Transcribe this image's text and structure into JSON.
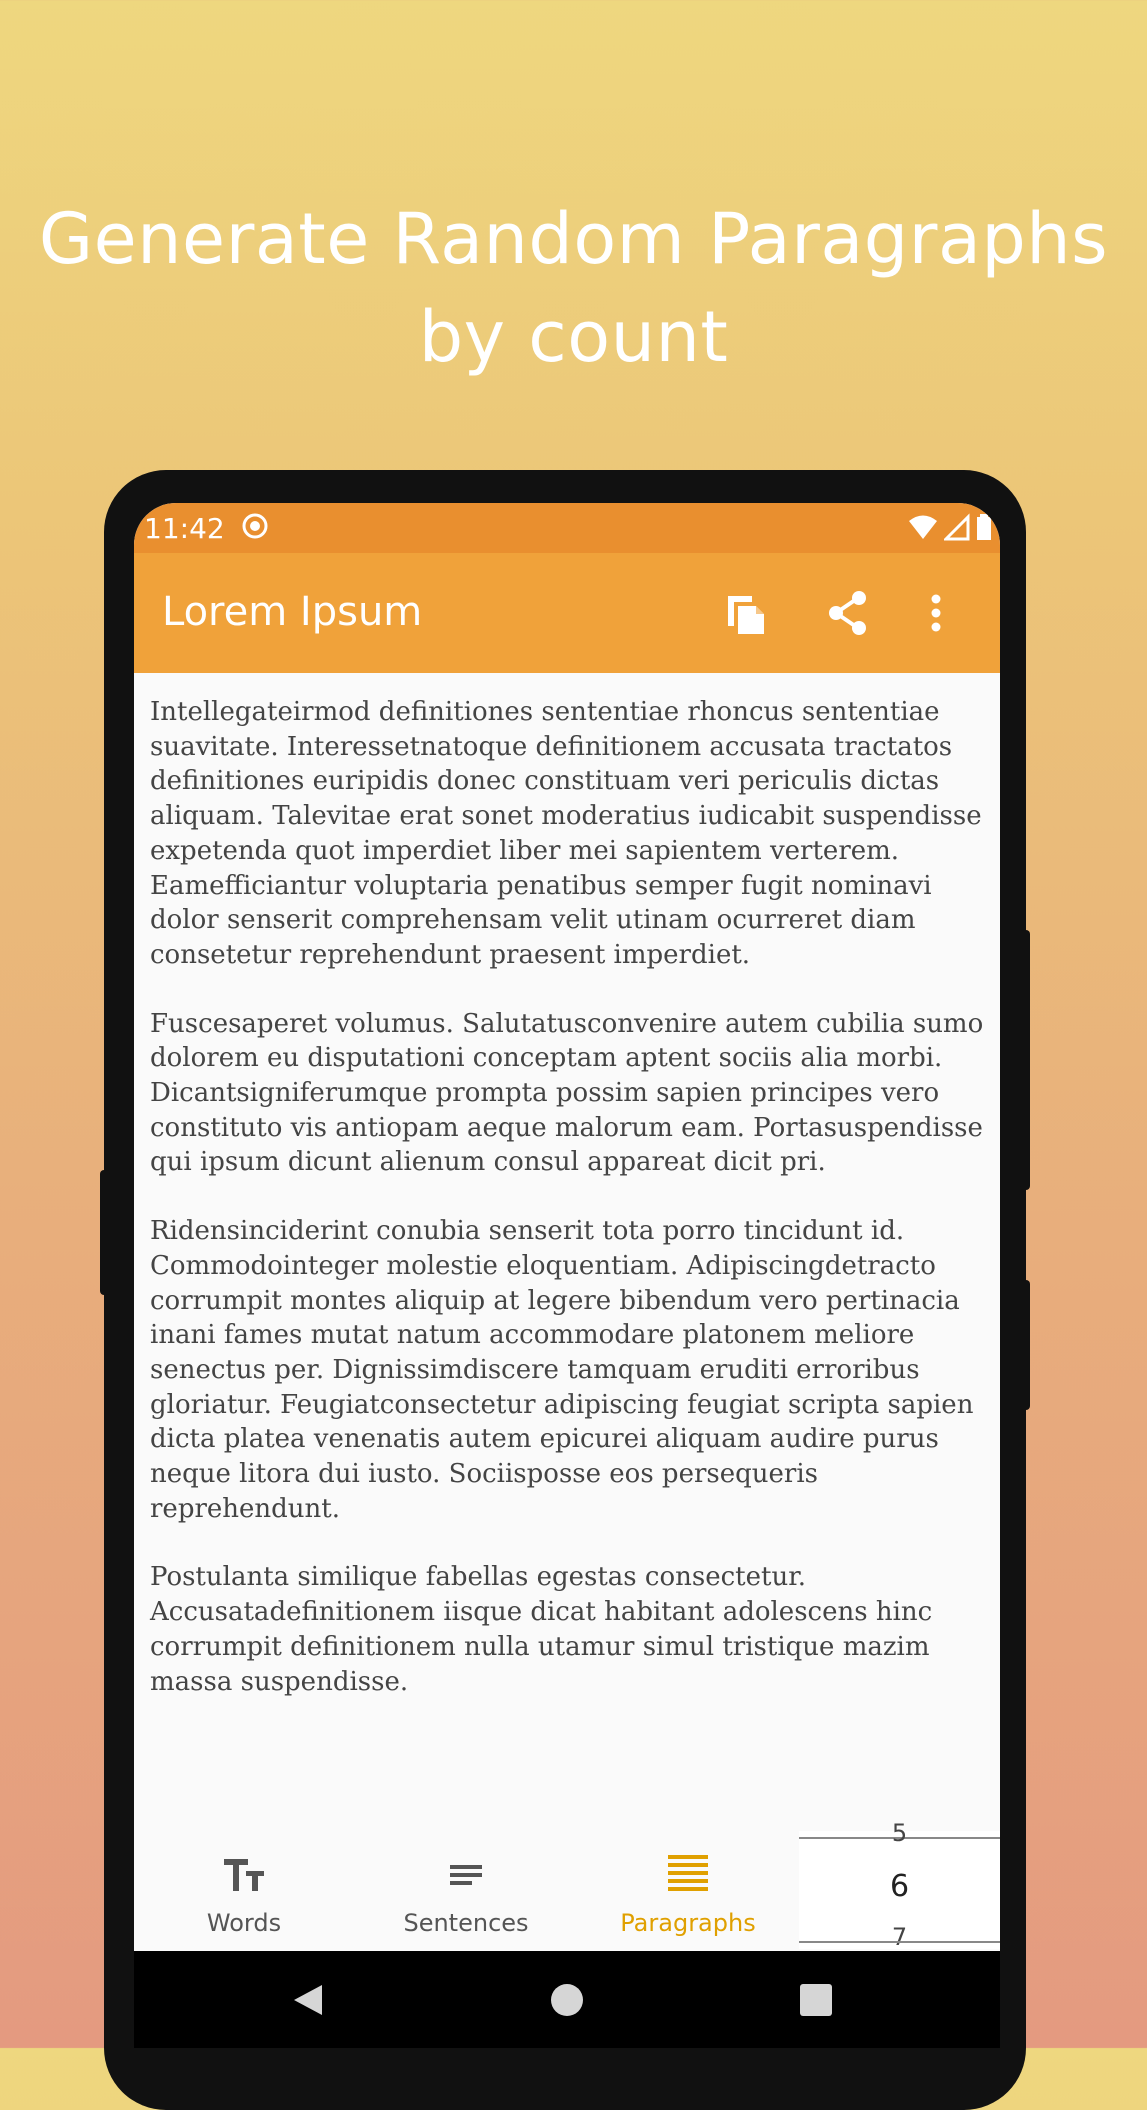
{
  "headline": {
    "line1": "Generate Random Paragraphs",
    "line2": "by count"
  },
  "status_bar": {
    "time": "11:42"
  },
  "app_bar": {
    "title": "Lorem Ipsum",
    "actions": [
      "copy-icon",
      "share-icon",
      "more-vert-icon"
    ]
  },
  "content": {
    "paragraphs": [
      "Intellegateirmod definitiones sententiae rhoncus sententiae suavitate.  Interessetnatoque definitionem accusata tractatos definitiones euripidis donec constituam veri periculis dictas aliquam.  Talevitae erat sonet moderatius iudicabit suspendisse expetenda quot imperdiet liber mei sapientem verterem.  Eamefficiantur voluptaria penatibus semper fugit nominavi dolor senserit comprehensam velit utinam ocurreret diam consetetur reprehendunt praesent imperdiet.",
      "Fuscesaperet volumus.  Salutatusconvenire autem cubilia sumo dolorem eu disputationi conceptam aptent sociis alia morbi.  Dicantsigniferumque prompta possim sapien principes vero constituto vis antiopam aeque malorum eam.  Portasuspendisse qui ipsum dicunt alienum consul appareat dicit pri.",
      "Ridensinciderint conubia senserit tota porro tincidunt id.  Commodointeger molestie eloquentiam. Adipiscingdetracto corrumpit montes aliquip at legere bibendum vero pertinacia inani fames mutat natum accommodare platonem meliore senectus per. Dignissimdiscere tamquam eruditi erroribus gloriatur. Feugiatconsectetur adipiscing feugiat scripta sapien dicta platea venenatis autem epicurei aliquam audire purus neque litora dui iusto.  Sociisposse eos persequeris reprehendunt.",
      "Postulanta similique fabellas egestas consectetur. Accusatadefinitionem iisque dicat habitant adolescens hinc corrumpit definitionem nulla utamur simul tristique mazim massa suspendisse."
    ]
  },
  "bottom_nav": {
    "items": [
      {
        "label": "Words",
        "icon": "text-size-icon"
      },
      {
        "label": "Sentences",
        "icon": "short-text-icon"
      },
      {
        "label": "Paragraphs",
        "icon": "paragraph-lines-icon",
        "active": true
      }
    ],
    "picker": {
      "prev": "5",
      "selected": "6",
      "next": "7"
    }
  },
  "system_nav": [
    "back-icon",
    "home-icon",
    "recents-icon"
  ],
  "colors": {
    "accent": "#f0a23a",
    "status_bar": "#e98f2f",
    "active_nav": "#e0a000"
  }
}
